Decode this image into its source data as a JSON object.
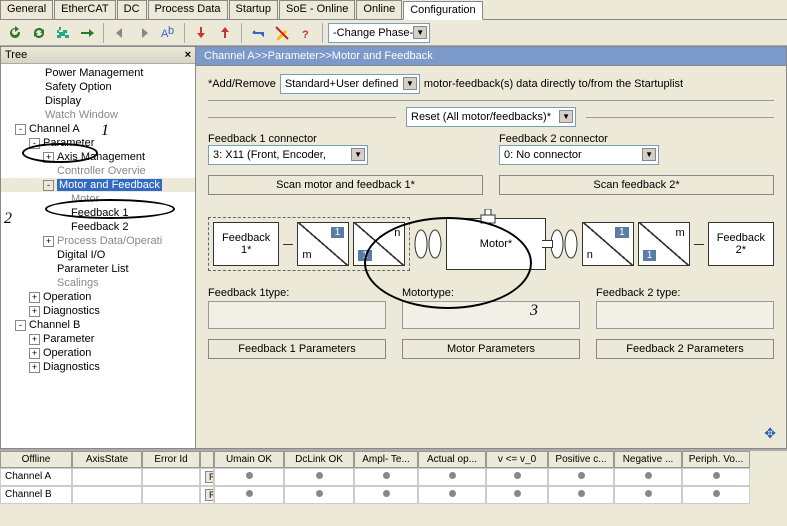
{
  "tabs": [
    "General",
    "EtherCAT",
    "DC",
    "Process Data",
    "Startup",
    "SoE - Online",
    "Online",
    "Configuration"
  ],
  "active_tab": "Configuration",
  "toolbar": {
    "phase_combo": "-Change Phase-"
  },
  "tree": {
    "title": "Tree",
    "nodes": [
      {
        "ind": 28,
        "tw": "",
        "lbl": "Power Management"
      },
      {
        "ind": 28,
        "tw": "",
        "lbl": "Safety Option"
      },
      {
        "ind": 28,
        "tw": "",
        "lbl": "Display"
      },
      {
        "ind": 28,
        "tw": "",
        "lbl": "Watch Window",
        "dim": true
      },
      {
        "ind": 12,
        "tw": "-",
        "lbl": "Channel A"
      },
      {
        "ind": 26,
        "tw": "-",
        "lbl": "Parameter"
      },
      {
        "ind": 40,
        "tw": "+",
        "lbl": "Axis Management"
      },
      {
        "ind": 40,
        "tw": "",
        "lbl": "Controller Overvie",
        "dim": true
      },
      {
        "ind": 40,
        "tw": "-",
        "lbl": "Motor and Feedback",
        "sel": true
      },
      {
        "ind": 54,
        "tw": "",
        "lbl": "Motor",
        "dim": true
      },
      {
        "ind": 54,
        "tw": "",
        "lbl": "Feedback 1"
      },
      {
        "ind": 54,
        "tw": "",
        "lbl": "Feedback 2"
      },
      {
        "ind": 40,
        "tw": "+",
        "lbl": "Process Data/Operati",
        "dim": true
      },
      {
        "ind": 40,
        "tw": "",
        "lbl": "Digital I/O"
      },
      {
        "ind": 40,
        "tw": "",
        "lbl": "Parameter List"
      },
      {
        "ind": 40,
        "tw": "",
        "lbl": "Scalings",
        "dim": true
      },
      {
        "ind": 26,
        "tw": "+",
        "lbl": "Operation"
      },
      {
        "ind": 26,
        "tw": "+",
        "lbl": "Diagnostics"
      },
      {
        "ind": 12,
        "tw": "-",
        "lbl": "Channel B"
      },
      {
        "ind": 26,
        "tw": "+",
        "lbl": "Parameter"
      },
      {
        "ind": 26,
        "tw": "+",
        "lbl": "Operation"
      },
      {
        "ind": 26,
        "tw": "+",
        "lbl": "Diagnostics"
      }
    ]
  },
  "breadcrumb": "Channel A>>Parameter>>Motor and Feedback",
  "content": {
    "addremove_prefix": "*Add/Remove",
    "addremove_combo": "Standard+User defined",
    "addremove_suffix": "motor-feedback(s) data directly to/from the Startuplist",
    "reset_btn": "Reset (All motor/feedbacks)*",
    "fb1_conn_label": "Feedback 1 connector",
    "fb1_conn_value": "3: X11 (Front, Encoder,",
    "fb2_conn_label": "Feedback 2 connector",
    "fb2_conn_value": "0: No connector",
    "scan1_btn": "Scan motor and feedback 1*",
    "scan2_btn": "Scan feedback 2*",
    "fb1_block": "Feedback\n1*",
    "motor_block": "Motor*",
    "fb2_block": "Feedback\n2*",
    "frac_num": "1",
    "frac_m": "m",
    "frac_n": "n",
    "fb1_type_label": "Feedback 1type:",
    "motor_type_label": "Motortype:",
    "fb2_type_label": "Feedback 2 type:",
    "fb1_params_btn": "Feedback 1 Parameters",
    "motor_params_btn": "Motor Parameters",
    "fb2_params_btn": "Feedback 2 Parameters"
  },
  "grid": {
    "headers": [
      "Offline",
      "AxisState",
      "Error Id",
      "",
      "Umain OK",
      "DcLink OK",
      "Ampl- Te...",
      "Actual op...",
      "v <= v_0",
      "Positive c...",
      "Negative ...",
      "Periph. Vo..."
    ],
    "rows": [
      {
        "c0": "Channel A",
        "c3": "R"
      },
      {
        "c0": "Channel B",
        "c3": "R"
      }
    ]
  },
  "callouts": {
    "n1": "1",
    "n2": "2",
    "n3": "3"
  }
}
